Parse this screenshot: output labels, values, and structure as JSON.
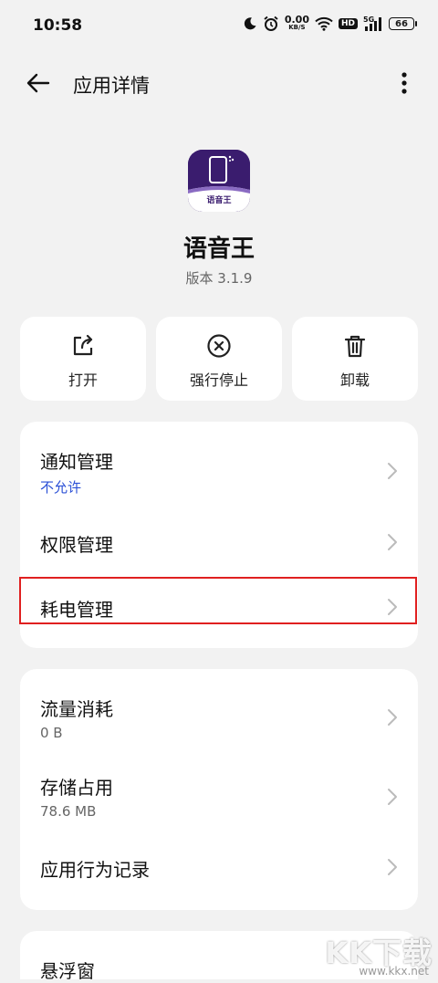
{
  "status_bar": {
    "time": "10:58",
    "net_speed_value": "0.00",
    "net_speed_unit": "KB/S",
    "hd_label": "HD",
    "signal_label": "5G",
    "battery_level": "66"
  },
  "header": {
    "title": "应用详情"
  },
  "app": {
    "name": "语音王",
    "version": "版本 3.1.9",
    "icon_text": "语音王"
  },
  "actions": [
    {
      "label": "打开",
      "icon": "open-share-icon"
    },
    {
      "label": "强行停止",
      "icon": "force-stop-icon"
    },
    {
      "label": "卸载",
      "icon": "trash-icon"
    }
  ],
  "settings_group_1": [
    {
      "title": "通知管理",
      "subtitle": "不允许"
    },
    {
      "title": "权限管理"
    },
    {
      "title": "耗电管理"
    }
  ],
  "settings_group_2": [
    {
      "title": "流量消耗",
      "subtitle": "0 B"
    },
    {
      "title": "存储占用",
      "subtitle": "78.6 MB"
    },
    {
      "title": "应用行为记录"
    }
  ],
  "settings_group_3": [
    {
      "title": "悬浮窗"
    }
  ],
  "watermark": {
    "text": "KK下载",
    "url": "www.kkx.net"
  },
  "colors": {
    "background": "#f2f2f2",
    "card": "#ffffff",
    "link_blue": "#2a4fd6",
    "highlight_red": "#e02020",
    "app_icon_purple": "#3a1c6e"
  }
}
